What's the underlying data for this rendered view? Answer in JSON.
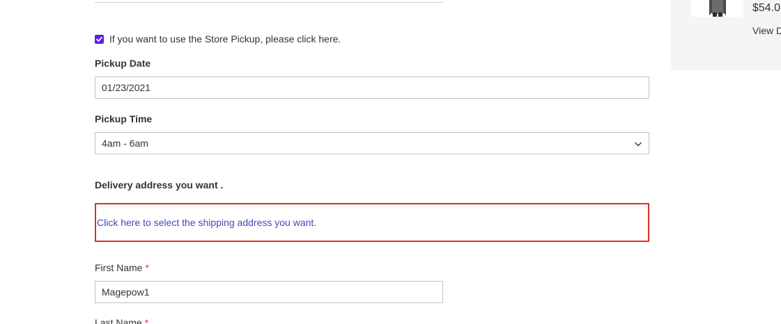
{
  "pickup": {
    "checkbox_label": "If you want to use the Store Pickup, please click here.",
    "checked": true,
    "date_label": "Pickup Date",
    "date_value": "01/23/2021",
    "time_label": "Pickup Time",
    "time_value": "4am - 6am"
  },
  "delivery": {
    "heading": "Delivery address you want .",
    "select_link": "Click here to select the shipping address you want."
  },
  "form": {
    "first_name_label": "First Name",
    "first_name_value": "Magepow1",
    "last_name_label": "Last Name",
    "required_mark": "*"
  },
  "summary": {
    "price": "$54.0",
    "view_details": "View D"
  },
  "colors": {
    "checkbox": "#5b21e6",
    "highlight_border": "#e02b27",
    "link": "#3f4abf",
    "required": "#e02b27"
  },
  "icons": {
    "select_arrow": "chevron-down-icon",
    "checkbox_mark": "check-icon"
  }
}
